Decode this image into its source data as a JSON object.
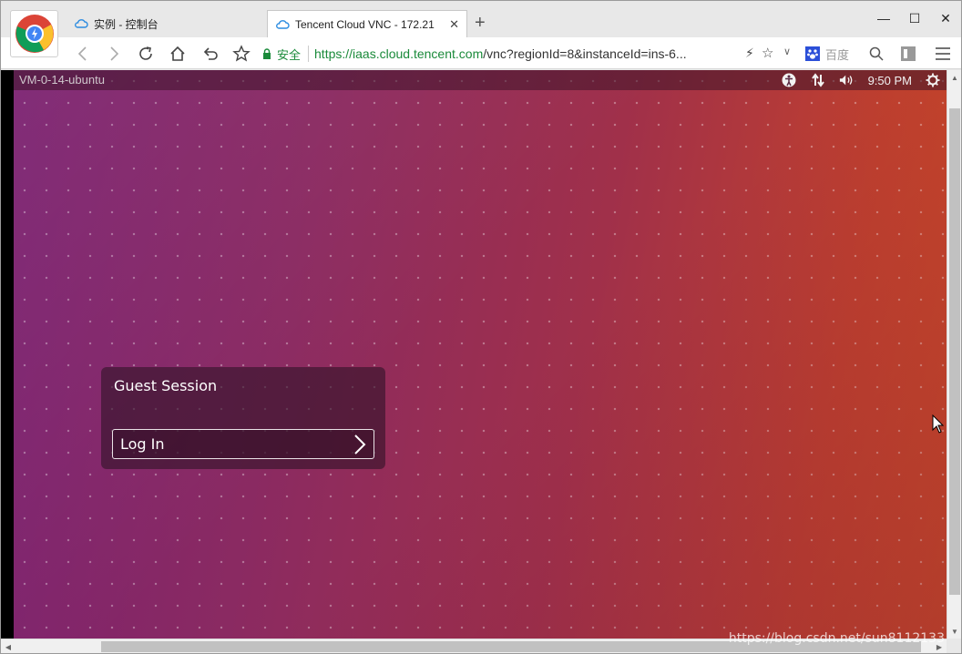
{
  "browser": {
    "tabs": [
      {
        "label": "实例 - 控制台",
        "active": false
      },
      {
        "label": "Tencent Cloud VNC - 172.21",
        "active": true
      }
    ],
    "url": {
      "secure_label": "安全",
      "host": "https://iaas.cloud.tencent.com",
      "path": "/vnc?regionId=8&instanceId=ins-6..."
    },
    "search_engine_label": "百度"
  },
  "desktop": {
    "hostname": "VM-0-14-ubuntu",
    "clock": "9:50 PM",
    "session_name": "Guest Session",
    "login_button_label": "Log In"
  },
  "watermark": "https://blog.csdn.net/sun8112133",
  "colors": {
    "ubuntu_purple": "#7a2070",
    "ubuntu_orange": "#cd4a27",
    "secure_green": "#1a8a3a"
  }
}
